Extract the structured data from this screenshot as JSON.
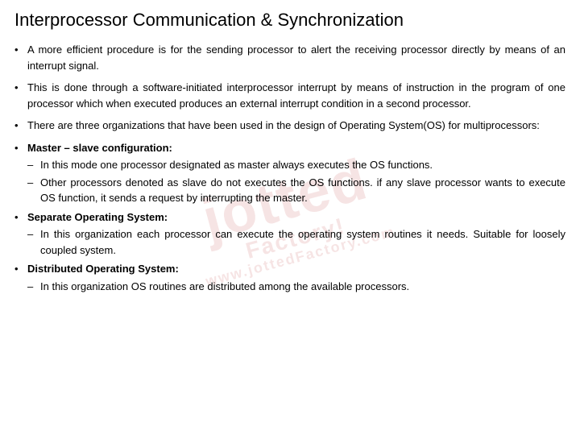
{
  "title": "Interprocessor Communication & Synchronization",
  "watermark": {
    "line1": "jotted",
    "line2": "Factory!",
    "url": "www.jottedFactory.com"
  },
  "bullets": [
    {
      "id": "bullet1",
      "text": "A more efficient procedure is for the sending processor to alert the receiving processor directly by means of an interrupt signal.",
      "type": "normal"
    },
    {
      "id": "bullet2",
      "text": "This is done through a software-initiated interprocessor interrupt by means of instruction in the program of one processor which when executed produces an external interrupt condition in a second processor.",
      "type": "normal"
    },
    {
      "id": "bullet3",
      "text": "There are three organizations that have been used in the design of Operating System(OS) for multiprocessors:",
      "type": "normal"
    },
    {
      "id": "bullet4",
      "heading": "Master – slave configuration:",
      "type": "heading",
      "subitems": [
        "In this mode one processor designated as master always executes the OS functions.",
        "Other processors denoted as slave do not executes the OS functions. if any slave processor wants to execute OS function, it sends a request by interrupting the master."
      ]
    },
    {
      "id": "bullet5",
      "heading": "Separate Operating System:",
      "type": "heading",
      "subitems": [
        "In this organization each processor can execute the operating system routines it needs. Suitable for loosely coupled system."
      ]
    },
    {
      "id": "bullet6",
      "heading": "Distributed Operating System:",
      "type": "heading",
      "subitems": [
        "In this organization OS routines are distributed among the available processors."
      ]
    }
  ]
}
